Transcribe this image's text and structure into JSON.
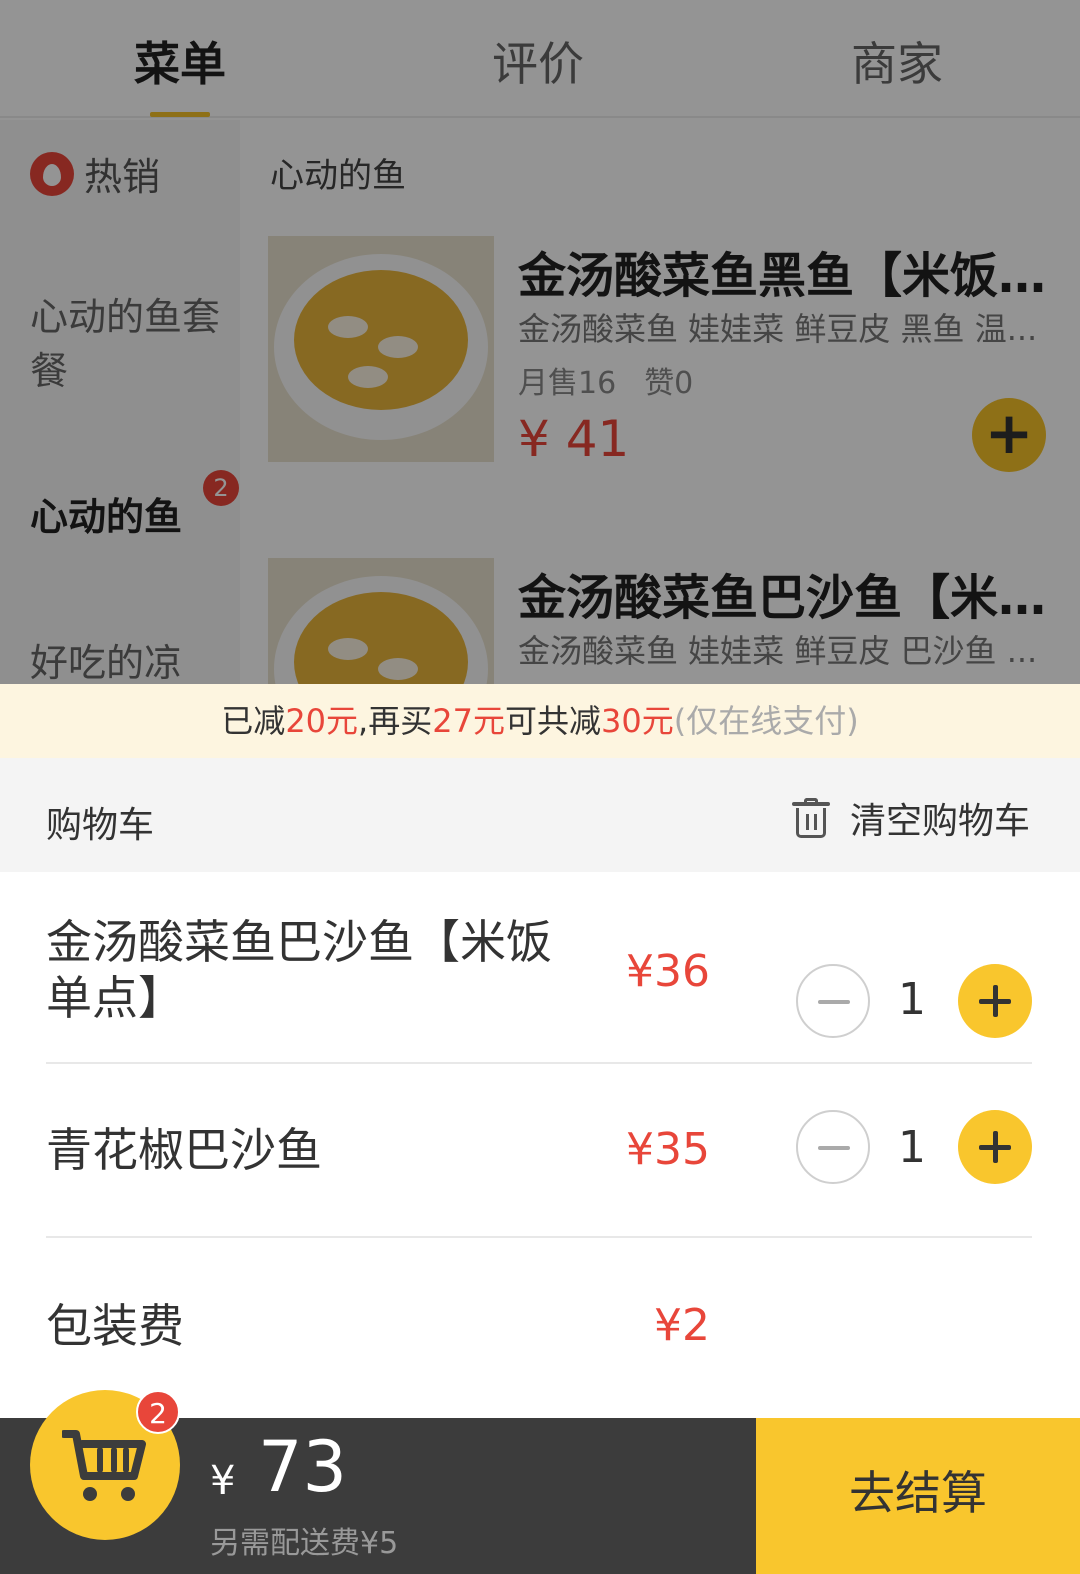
{
  "tabs": [
    {
      "label": "菜单",
      "active": true
    },
    {
      "label": "评价",
      "active": false
    },
    {
      "label": "商家",
      "active": false
    }
  ],
  "sidebar": {
    "hot_label": "热销",
    "items": [
      {
        "label": "心动的鱼套餐"
      },
      {
        "label": "心动的鱼",
        "badge": "2"
      },
      {
        "label": "好吃的凉"
      }
    ]
  },
  "menu": {
    "section_title": "心动的鱼",
    "dishes": [
      {
        "name": "金汤酸菜鱼黑鱼【米饭...",
        "desc": "金汤酸菜鱼 娃娃菜 鲜豆皮 黑鱼 温...",
        "monthly_sales": "月售16",
        "likes": "赞0",
        "price": "¥ 41"
      },
      {
        "name": "金汤酸菜鱼巴沙鱼【米...",
        "desc": "金汤酸菜鱼 娃娃菜 鲜豆皮 巴沙鱼 ..."
      }
    ]
  },
  "discount": {
    "prefix": "已减",
    "reduced": "20元",
    "mid": ",再买",
    "more": "27元",
    "mid2": "可共减",
    "total": "30元",
    "note": "(仅在线支付)"
  },
  "cart": {
    "title": "购物车",
    "clear_label": "清空购物车",
    "items": [
      {
        "name": "金汤酸菜鱼巴沙鱼【米饭单点】",
        "price": "¥36",
        "qty": "1"
      },
      {
        "name": "青花椒巴沙鱼",
        "price": "¥35",
        "qty": "1"
      }
    ],
    "packaging": {
      "name": "包装费",
      "price": "¥2"
    }
  },
  "bottom_bar": {
    "cart_count": "2",
    "currency": "¥",
    "total": "73",
    "delivery_note": "另需配送费¥5",
    "checkout_label": "去结算"
  },
  "colors": {
    "accent": "#f9c62d",
    "price_red": "#e8463a",
    "bottom_bar_bg": "#3c3c3c"
  }
}
